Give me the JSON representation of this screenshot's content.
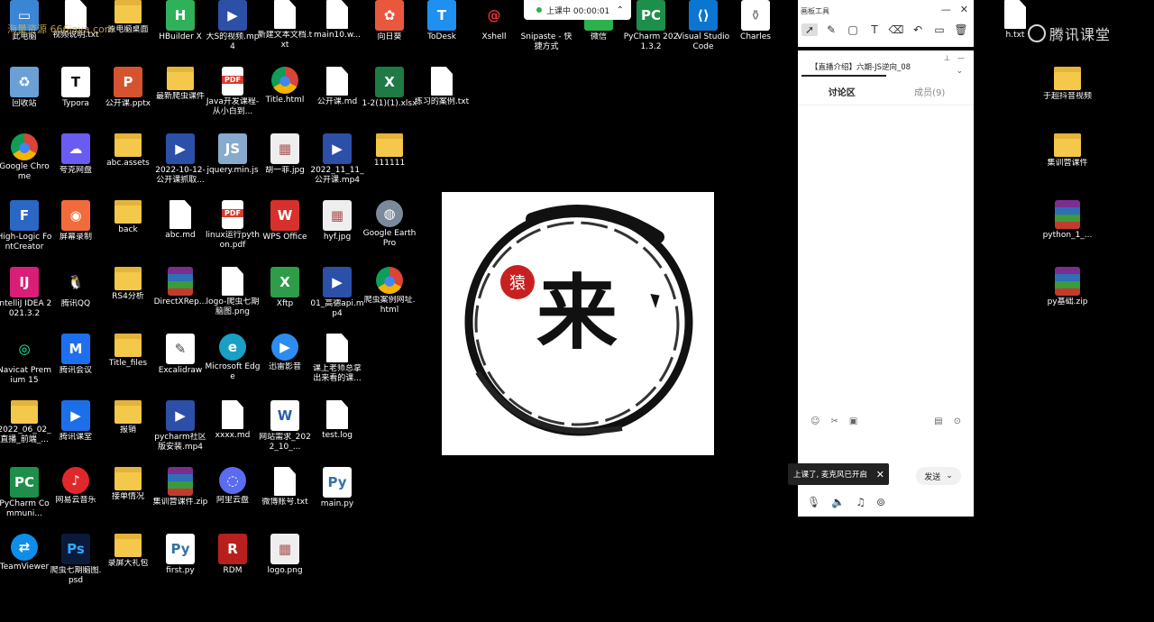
{
  "watermark": "海量资源 666java.com",
  "brand": "腾讯课堂",
  "class_status": {
    "label": "上课中 00:00:01"
  },
  "whiteboard": {
    "title": "画板工具"
  },
  "chat": {
    "title": "【直播介绍】六期-JS逆向_08",
    "tabs": [
      {
        "label": "讨论区"
      },
      {
        "label": "成员(9)"
      }
    ],
    "send_label": "发送",
    "toast": "上课了, 麦克风已开启"
  },
  "logo_text": {
    "seal": "猿",
    "main": "来"
  },
  "icons": [
    {
      "label": "此电脑",
      "type": "pc"
    },
    {
      "label": "视频说明.txt",
      "type": "doc"
    },
    {
      "label": "原电脑桌面",
      "type": "folder"
    },
    {
      "label": "HBuilder X",
      "type": "hbuilder"
    },
    {
      "label": "大S的视频.mp4",
      "type": "video"
    },
    {
      "label": "新建文本文档.txt",
      "type": "doc"
    },
    {
      "label": "main10.w...",
      "type": "doc"
    },
    {
      "label": "向日葵",
      "type": "sunflower"
    },
    {
      "label": "ToDesk",
      "type": "todesk"
    },
    {
      "label": "Xshell",
      "type": "xshell"
    },
    {
      "label": "Snipaste - 快捷方式",
      "type": "snipaste"
    },
    {
      "label": "微信",
      "type": "wechat"
    },
    {
      "label": "PyCharm 2021.3.2",
      "type": "pycharm"
    },
    {
      "label": "Visual Studio Code",
      "type": "vscode"
    },
    {
      "label": "Charles",
      "type": "charles"
    },
    {
      "label": "h.txt",
      "type": "doc"
    },
    {
      "label": "回收站",
      "type": "recycle"
    },
    {
      "label": "Typora",
      "type": "typora"
    },
    {
      "label": "公开课.pptx",
      "type": "pptx"
    },
    {
      "label": "最新爬虫课件",
      "type": "folder"
    },
    {
      "label": "Java开发课程-从小白到...",
      "type": "pdf"
    },
    {
      "label": "Title.html",
      "type": "chrome"
    },
    {
      "label": "公开课.md",
      "type": "md"
    },
    {
      "label": "1-2(1)(1).xlsx",
      "type": "xlsx"
    },
    {
      "label": "练习的案例.txt",
      "type": "doc"
    },
    {
      "label": "于超抖音视频",
      "type": "folder"
    },
    {
      "label": "Google Chrome",
      "type": "chrome"
    },
    {
      "label": "夸克网盘",
      "type": "quark"
    },
    {
      "label": "abc.assets",
      "type": "folder"
    },
    {
      "label": "2022-10-12-公开课抓取...",
      "type": "video"
    },
    {
      "label": "jquery.min.js",
      "type": "js"
    },
    {
      "label": "胡一菲.jpg",
      "type": "image"
    },
    {
      "label": "2022_11_11_公开课.mp4",
      "type": "video"
    },
    {
      "label": "111111",
      "type": "folder"
    },
    {
      "label": "集训营课件",
      "type": "folder"
    },
    {
      "label": "High-Logic FontCreator",
      "type": "fontcreator"
    },
    {
      "label": "屏幕录制",
      "type": "screenrec"
    },
    {
      "label": "back",
      "type": "folder"
    },
    {
      "label": "abc.md",
      "type": "md"
    },
    {
      "label": "linux运行python.pdf",
      "type": "pdf"
    },
    {
      "label": "WPS Office",
      "type": "wps"
    },
    {
      "label": "hyf.jpg",
      "type": "image"
    },
    {
      "label": "Google Earth Pro",
      "type": "earth"
    },
    {
      "label": "python_1_...",
      "type": "zip"
    },
    {
      "label": "IntelliJ IDEA 2021.3.2",
      "type": "idea"
    },
    {
      "label": "腾讯QQ",
      "type": "qq"
    },
    {
      "label": "RS4分析",
      "type": "folder"
    },
    {
      "label": "DirectXRep...",
      "type": "zip"
    },
    {
      "label": "logo-爬虫七期脑图.png",
      "type": "doc"
    },
    {
      "label": "Xftp",
      "type": "xftp"
    },
    {
      "label": "01_高德api.mp4",
      "type": "video"
    },
    {
      "label": "爬虫案例网址.html",
      "type": "chrome"
    },
    {
      "label": "py基础.zip",
      "type": "zip"
    },
    {
      "label": "Navicat Premium 15",
      "type": "navicat"
    },
    {
      "label": "腾讯会议",
      "type": "meeting"
    },
    {
      "label": "Title_files",
      "type": "folder"
    },
    {
      "label": "Excalidraw",
      "type": "excalidraw"
    },
    {
      "label": "Microsoft Edge",
      "type": "edge"
    },
    {
      "label": "迅雷影音",
      "type": "xunlei"
    },
    {
      "label": "课上老师总拿出来看的课...",
      "type": "doc"
    },
    {
      "label": "2022_06_02_直播_前端_...",
      "type": "folder"
    },
    {
      "label": "腾讯课堂",
      "type": "ketang"
    },
    {
      "label": "报销",
      "type": "folder"
    },
    {
      "label": "pycharm社区版安装.mp4",
      "type": "video"
    },
    {
      "label": "xxxx.md",
      "type": "md"
    },
    {
      "label": "网站需求_2022_10_...",
      "type": "word"
    },
    {
      "label": "test.log",
      "type": "doc"
    },
    {
      "label": "PyCharm Communi...",
      "type": "pycharm"
    },
    {
      "label": "网易云音乐",
      "type": "netease"
    },
    {
      "label": "接单情况",
      "type": "folder"
    },
    {
      "label": "集训营课件.zip",
      "type": "zip"
    },
    {
      "label": "阿里云盘",
      "type": "aliyun"
    },
    {
      "label": "微博账号.txt",
      "type": "doc"
    },
    {
      "label": "main.py",
      "type": "py"
    },
    {
      "label": "TeamViewer",
      "type": "teamviewer"
    },
    {
      "label": "爬虫七期脑图.psd",
      "type": "psd"
    },
    {
      "label": "录屏大礼包",
      "type": "folder"
    },
    {
      "label": "first.py",
      "type": "py"
    },
    {
      "label": "RDM",
      "type": "rdm"
    },
    {
      "label": "logo.png",
      "type": "image"
    }
  ]
}
